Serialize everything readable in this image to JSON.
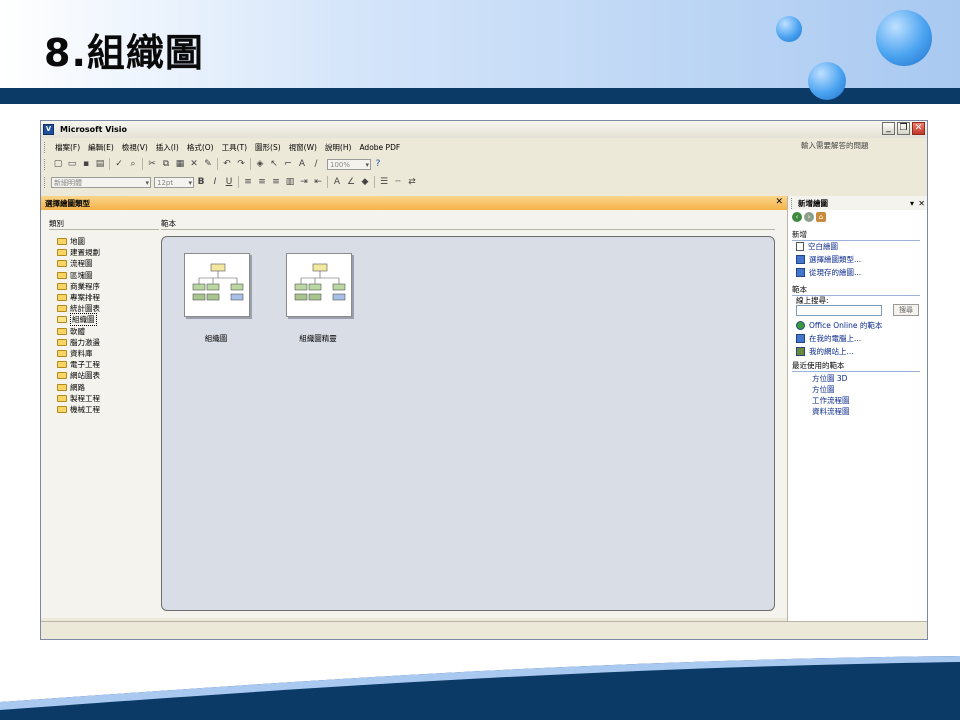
{
  "slide": {
    "title": "8.組織圖",
    "colors": {
      "band": "#0b3a66",
      "bubble": "#4aa3f0"
    }
  },
  "window": {
    "title": "Microsoft Visio",
    "icon": "visio-app-icon",
    "controls": {
      "minimize": "_",
      "restore": "❐",
      "close": "✕"
    }
  },
  "menubar": {
    "items": [
      "檔案(F)",
      "編輯(E)",
      "檢視(V)",
      "插入(I)",
      "格式(O)",
      "工具(T)",
      "圖形(S)",
      "視窗(W)",
      "說明(H)",
      "Adobe PDF"
    ],
    "help_placeholder": "輸入需要解答的問題"
  },
  "toolbar": {
    "zoom": "100%",
    "font": "新細明體",
    "size": "12pt"
  },
  "dialog": {
    "title": "選擇繪圖類型",
    "close": "✕",
    "category_label": "類別",
    "templates_label": "範本",
    "categories": [
      "地圖",
      "建置規劃",
      "流程圖",
      "區塊圖",
      "商業程序",
      "專案排程",
      "統計圖表",
      "組織圖",
      "軟體",
      "腦力激盪",
      "資料庫",
      "電子工程",
      "網站圖表",
      "網路",
      "製程工程",
      "機械工程"
    ],
    "selected_category": "組織圖",
    "templates": [
      {
        "label": "組織圖"
      },
      {
        "label": "組織圖精靈"
      }
    ]
  },
  "task_pane": {
    "title": "新增繪圖",
    "menu": "▾",
    "close": "✕",
    "new_section": "新增",
    "new_items": [
      "空白繪圖",
      "選擇繪圖類型...",
      "從現存的繪圖..."
    ],
    "templates_section": "範本",
    "online_search_label": "線上搜尋:",
    "search_button": "搜尋",
    "template_links": [
      "Office Online 的範本",
      "在我的電腦上...",
      "我的網站上..."
    ],
    "recent_section": "最近使用的範本",
    "recent_items": [
      "方位圖 3D",
      "方位圖",
      "工作流程圖",
      "資料流程圖"
    ]
  }
}
